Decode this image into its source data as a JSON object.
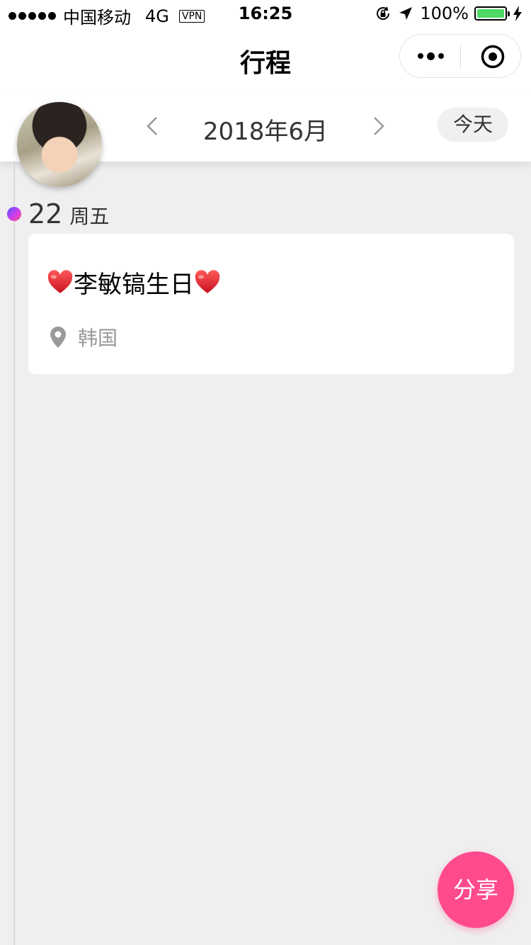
{
  "status_bar": {
    "carrier": "中国移动",
    "network": "4G",
    "vpn": "VPN",
    "time": "16:25",
    "battery_percent": "100%",
    "battery_level": 1.0,
    "battery_color": "#4cd964"
  },
  "navbar": {
    "title": "行程",
    "more_icon": "more-dots-icon",
    "close_icon": "target-circle-icon"
  },
  "calendar": {
    "month_label": "2018年6月",
    "prev_icon": "chevron-left-icon",
    "next_icon": "chevron-right-icon",
    "today_label": "今天"
  },
  "timeline": {
    "dot_colors": [
      "#4b5bff",
      "#c83cf0",
      "#ff4f8a"
    ],
    "days": [
      {
        "day": "22",
        "weekday": "周五",
        "events": [
          {
            "title": "李敏镐生日",
            "title_icons": [
              "heart-icon",
              "heart-icon"
            ],
            "location": "韩国",
            "location_icon": "map-pin-icon"
          }
        ]
      }
    ]
  },
  "share_button": {
    "label": "分享",
    "color": "#ff4a8d"
  }
}
